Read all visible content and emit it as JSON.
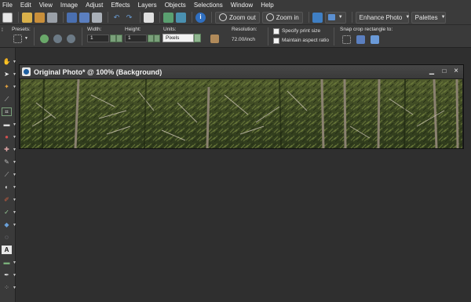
{
  "menu": [
    "File",
    "Edit",
    "View",
    "Image",
    "Adjust",
    "Effects",
    "Layers",
    "Objects",
    "Selections",
    "Window",
    "Help"
  ],
  "toolbar": {
    "zoom_out": "Zoom out",
    "zoom_in": "Zoom in",
    "enhance_photo": "Enhance Photo",
    "palettes": "Palettes"
  },
  "options": {
    "presets_label": "Presets:",
    "width_label": "Width:",
    "width_value": "1",
    "height_label": "Height:",
    "height_value": "1",
    "units_label": "Units:",
    "units_value": "Pixels",
    "resolution_label": "Resolution:",
    "resolution_value": "72.00/inch",
    "specify_print_size": "Specify print size",
    "maintain_aspect_ratio": "Maintain aspect ratio",
    "snap_label": "Snap crop rectangle to:"
  },
  "image_window": {
    "title": "Original Photo* @ 100% (Background)",
    "minimize": "▁",
    "maximize": "□",
    "close": "×"
  },
  "colors": {
    "accent_green": "#7aa07a",
    "app_blue": "#1f5fa0"
  }
}
